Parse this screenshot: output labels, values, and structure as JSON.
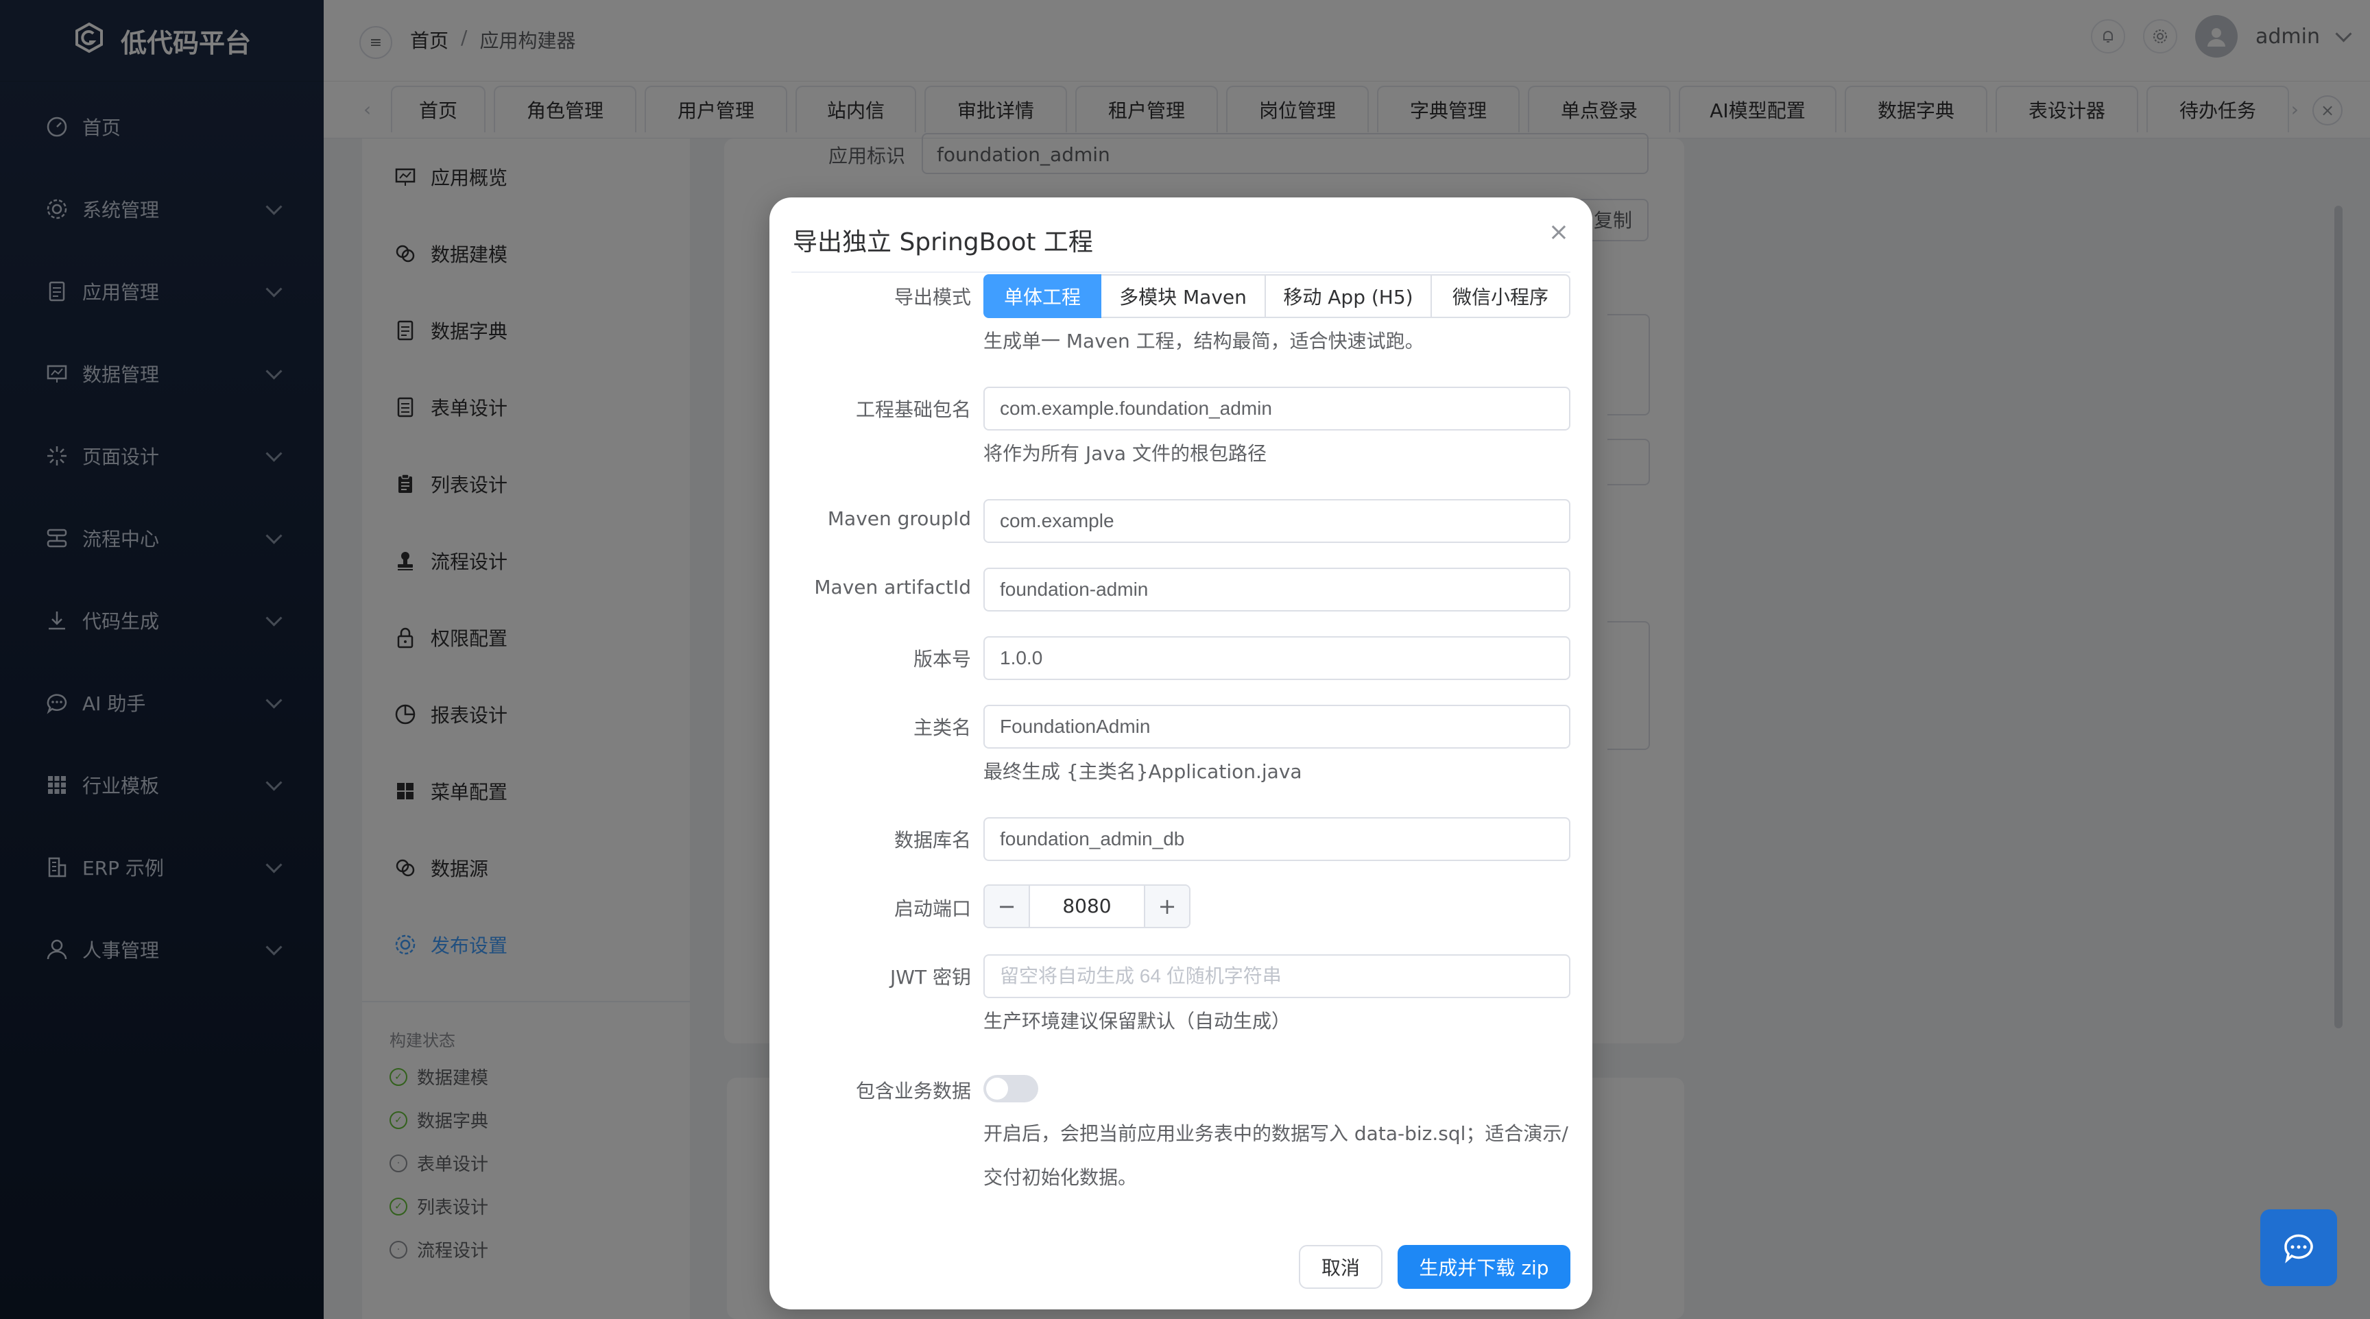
{
  "app": {
    "title": "低代码平台"
  },
  "sidebar": {
    "items": [
      {
        "label": "首页",
        "icon": "dashboard-icon",
        "has_children": false
      },
      {
        "label": "系统管理",
        "icon": "gear-icon",
        "has_children": true
      },
      {
        "label": "应用管理",
        "icon": "document-icon",
        "has_children": true
      },
      {
        "label": "数据管理",
        "icon": "presentation-icon",
        "has_children": true
      },
      {
        "label": "页面设计",
        "icon": "sparkle-icon",
        "has_children": true
      },
      {
        "label": "流程中心",
        "icon": "flow-icon",
        "has_children": true
      },
      {
        "label": "代码生成",
        "icon": "download-icon",
        "has_children": true
      },
      {
        "label": "AI 助手",
        "icon": "chat-icon",
        "has_children": true
      },
      {
        "label": "行业模板",
        "icon": "grid-icon",
        "has_children": true
      },
      {
        "label": "ERP 示例",
        "icon": "building-icon",
        "has_children": true
      },
      {
        "label": "人事管理",
        "icon": "user-icon",
        "has_children": true
      }
    ]
  },
  "header": {
    "breadcrumb": [
      "首页",
      "应用构建器"
    ],
    "user": "admin"
  },
  "tabs": [
    "首页",
    "角色管理",
    "用户管理",
    "站内信",
    "审批详情",
    "租户管理",
    "岗位管理",
    "字典管理",
    "单点登录",
    "AI模型配置",
    "数据字典",
    "表设计器",
    "待办任务"
  ],
  "builder_nav": {
    "items": [
      {
        "label": "应用概览",
        "icon": "presentation-icon"
      },
      {
        "label": "数据建模",
        "icon": "database-icon"
      },
      {
        "label": "数据字典",
        "icon": "document-icon"
      },
      {
        "label": "表单设计",
        "icon": "form-icon"
      },
      {
        "label": "列表设计",
        "icon": "clipboard-icon"
      },
      {
        "label": "流程设计",
        "icon": "stamp-icon"
      },
      {
        "label": "权限配置",
        "icon": "lock-icon"
      },
      {
        "label": "报表设计",
        "icon": "pie-icon"
      },
      {
        "label": "菜单配置",
        "icon": "grid-icon"
      },
      {
        "label": "数据源",
        "icon": "database-icon"
      },
      {
        "label": "发布设置",
        "icon": "gear-icon"
      }
    ],
    "active_index": 10,
    "build_status_title": "构建状态",
    "build_status": [
      {
        "label": "数据建模",
        "done": true
      },
      {
        "label": "数据字典",
        "done": true
      },
      {
        "label": "表单设计",
        "done": false
      },
      {
        "label": "列表设计",
        "done": true
      },
      {
        "label": "流程设计",
        "done": false
      }
    ]
  },
  "background_form": {
    "app_id_label": "应用标识",
    "app_id_value": "foundation_admin",
    "copy_label": "复制"
  },
  "dialog": {
    "title": "导出独立 SpringBoot 工程",
    "export_mode_label": "导出模式",
    "export_modes": [
      "单体工程",
      "多模块 Maven",
      "移动 App (H5)",
      "微信小程序"
    ],
    "export_mode_selected": 0,
    "export_mode_help": "生成单一 Maven 工程，结构最简，适合快速试跑。",
    "base_package_label": "工程基础包名",
    "base_package_value": "com.example.foundation_admin",
    "base_package_help": "将作为所有 Java 文件的根包路径",
    "group_id_label": "Maven groupId",
    "group_id_value": "com.example",
    "artifact_id_label": "Maven artifactId",
    "artifact_id_value": "foundation-admin",
    "version_label": "版本号",
    "version_value": "1.0.0",
    "main_class_label": "主类名",
    "main_class_value": "FoundationAdmin",
    "main_class_help": "最终生成 {主类名}Application.java",
    "db_name_label": "数据库名",
    "db_name_value": "foundation_admin_db",
    "port_label": "启动端口",
    "port_value": "8080",
    "jwt_label": "JWT 密钥",
    "jwt_placeholder": "留空将自动生成 64 位随机字符串",
    "jwt_help": "生产环境建议保留默认（自动生成）",
    "biz_data_label": "包含业务数据",
    "biz_data_enabled": false,
    "biz_data_help_line1": "开启后，会把当前应用业务表中的数据写入 data-biz.sql；适合演示/",
    "biz_data_help_line2": "交付初始化数据。",
    "cancel_label": "取消",
    "submit_label": "生成并下载 zip"
  },
  "colors": {
    "primary": "#409eff",
    "sidebar_bg": "#1d2b45",
    "success": "#67c23a"
  }
}
